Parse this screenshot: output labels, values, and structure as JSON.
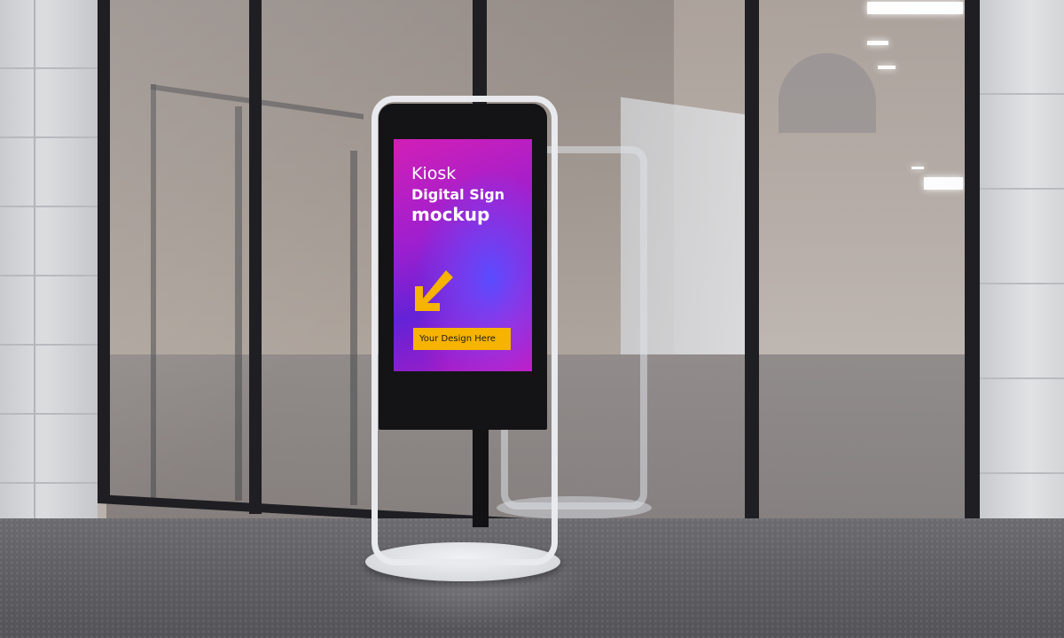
{
  "screen": {
    "title_line1": "Kiosk",
    "title_line2": "Digital Sign",
    "title_line3": "mockup",
    "cta_label": "Your Design Here",
    "arrow_icon": "arrow-down-left-icon"
  },
  "colors": {
    "screen_magenta": "#d21fb6",
    "screen_purple": "#6422d6",
    "accent_yellow": "#f6b300",
    "kiosk_black": "#141416",
    "kiosk_frame": "#e9eaee"
  }
}
